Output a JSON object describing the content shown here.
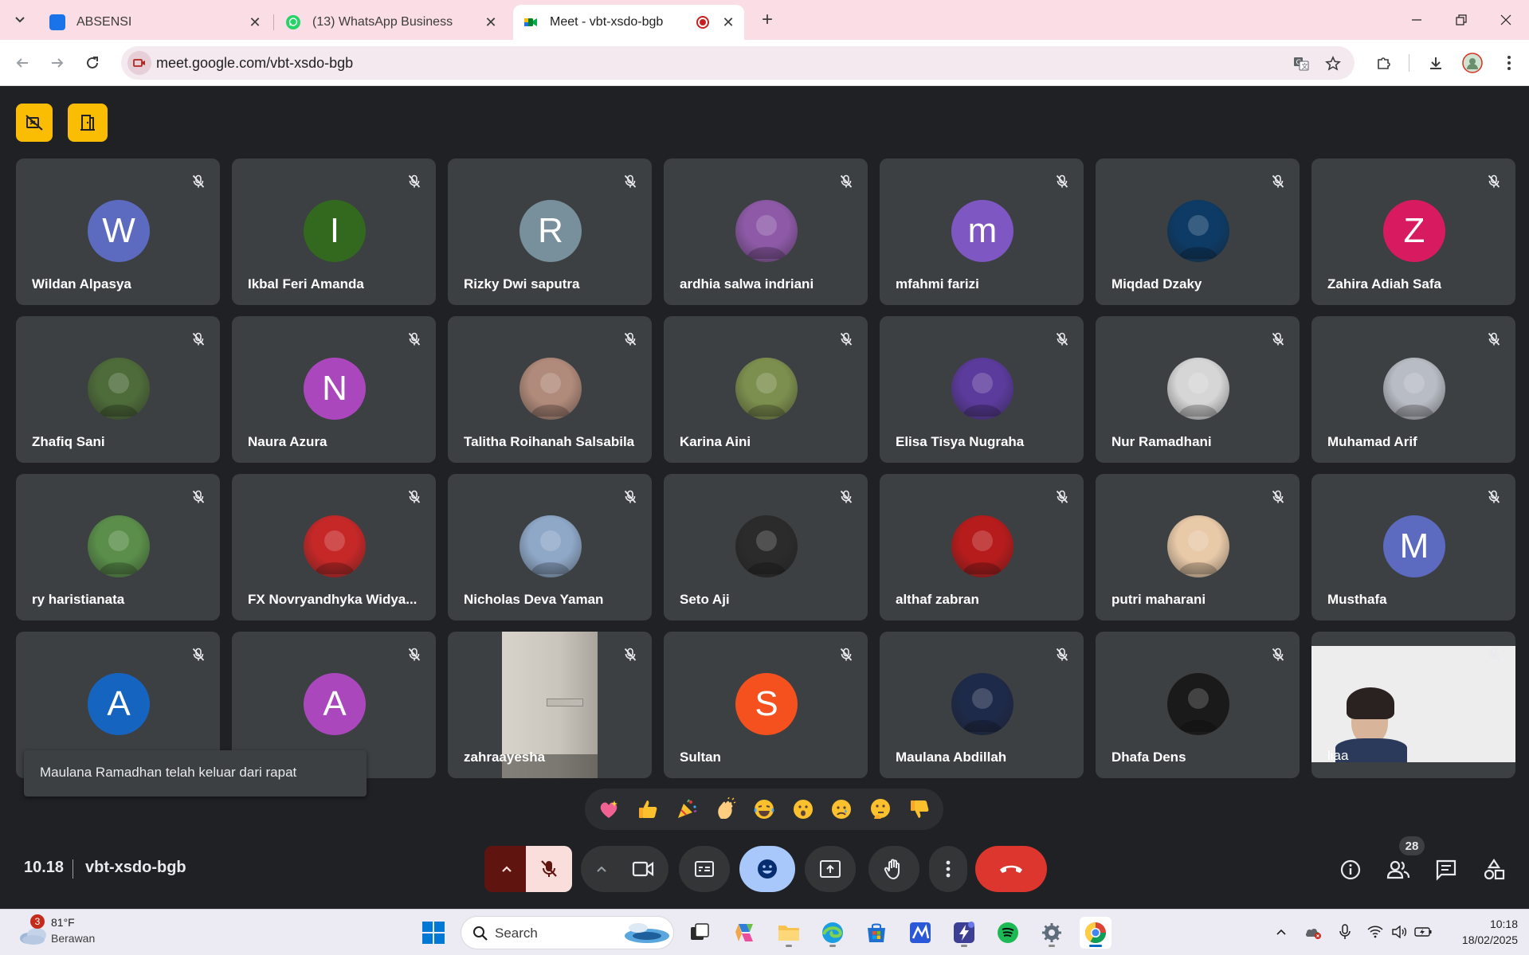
{
  "browser": {
    "tabs": [
      {
        "title": "ABSENSI",
        "favicon_color": "#1a73e8"
      },
      {
        "title": "(13) WhatsApp Business",
        "favicon_color": "#25d366"
      },
      {
        "title": "Meet - vbt-xsdo-bgb",
        "favicon_color": "#00832d"
      }
    ],
    "new_tab_label": "+",
    "url": "meet.google.com/vbt-xsdo-bgb"
  },
  "meet": {
    "participants": [
      {
        "name": "Wildan Alpasya",
        "initial": "W",
        "color": "#5c6bc0"
      },
      {
        "name": "Ikbal Feri Amanda",
        "initial": "I",
        "color": "#33691e"
      },
      {
        "name": "Rizky Dwi saputra",
        "initial": "R",
        "color": "#78909c"
      },
      {
        "name": "ardhia salwa indriani",
        "initial": "",
        "color": "#8e5aa8"
      },
      {
        "name": "mfahmi farizi",
        "initial": "m",
        "color": "#7e57c2"
      },
      {
        "name": "Miqdad Dzaky",
        "initial": "",
        "color": "#0d3b66"
      },
      {
        "name": "Zahira Adiah Safa",
        "initial": "Z",
        "color": "#d81b60"
      },
      {
        "name": "Zhafiq Sani",
        "initial": "",
        "color": "#4e6b3a"
      },
      {
        "name": "Naura Azura",
        "initial": "N",
        "color": "#ab47bc"
      },
      {
        "name": "Talitha Roihanah Salsabila",
        "initial": "",
        "color": "#b08a7a"
      },
      {
        "name": "Karina Aini",
        "initial": "",
        "color": "#7d8f4e"
      },
      {
        "name": "Elisa Tisya Nugraha",
        "initial": "",
        "color": "#5b3b9c"
      },
      {
        "name": "Nur Ramadhani",
        "initial": "",
        "color": "#d6d6d6"
      },
      {
        "name": "Muhamad Arif",
        "initial": "",
        "color": "#b8bcc4"
      },
      {
        "name": "ry haristianata",
        "initial": "",
        "color": "#5a8e4a"
      },
      {
        "name": "FX Novryandhyka Widya...",
        "initial": "",
        "color": "#c62828"
      },
      {
        "name": "Nicholas Deva Yaman",
        "initial": "",
        "color": "#8fa8c8"
      },
      {
        "name": "Seto Aji",
        "initial": "",
        "color": "#2b2b2b"
      },
      {
        "name": "althaf zabran",
        "initial": "",
        "color": "#b71c1c"
      },
      {
        "name": "putri maharani",
        "initial": "",
        "color": "#e8c9a8"
      },
      {
        "name": "Musthafa",
        "initial": "M",
        "color": "#5c6bc0"
      },
      {
        "name": "",
        "initial": "A",
        "color": "#1565c0"
      },
      {
        "name": "",
        "initial": "A",
        "color": "#ab47bc"
      },
      {
        "name": "zahraayesha",
        "initial": "",
        "color": "#c9c4bc"
      },
      {
        "name": "Sultan",
        "initial": "S",
        "color": "#f4511e"
      },
      {
        "name": "Maulana Abdillah",
        "initial": "",
        "color": "#1e2a4a"
      },
      {
        "name": "Dhafa Dens",
        "initial": "",
        "color": "#1a1a1a"
      },
      {
        "name": "liaa",
        "initial": "",
        "color": "#e9e9e9"
      }
    ],
    "toast": "Maulana Ramadhan telah keluar dari rapat",
    "reactions": [
      "💖",
      "👍",
      "🎉",
      "👏",
      "😂",
      "😮",
      "😢",
      "🤔",
      "👎"
    ],
    "time": "10.18",
    "meeting_code": "vbt-xsdo-bgb",
    "participant_count": "28",
    "colors": {
      "accent_blue": "#a8c7fa",
      "hangup_red": "#dc362e",
      "mic_off": "#f9dedc",
      "topbtn": "#fbbc04"
    }
  },
  "taskbar": {
    "weather_badge": "3",
    "weather_temp": "81°F",
    "weather_desc": "Berawan",
    "search_label": "Search",
    "time": "10:18",
    "date": "18/02/2025"
  }
}
